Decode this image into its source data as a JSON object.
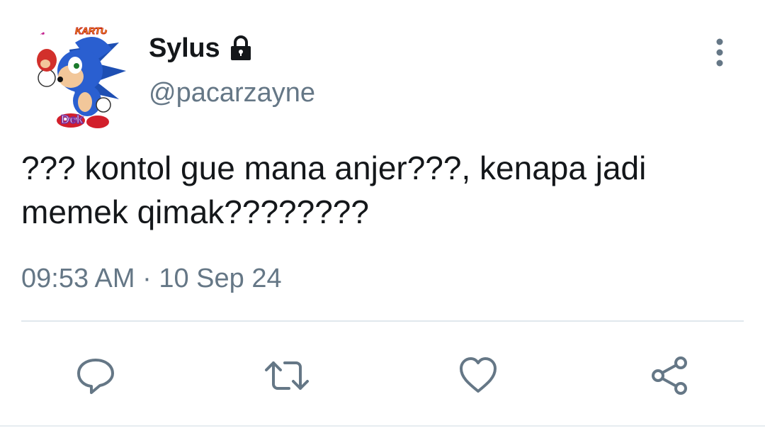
{
  "user": {
    "display_name": "Sylus",
    "handle": "@pacarzayne",
    "protected_icon": "lock-icon",
    "avatar": {
      "description_icon": "sonic-avatar",
      "badge_text": "Dek",
      "top_text_left": "ma",
      "top_text_right": "KARTU"
    }
  },
  "tweet": {
    "text": "??? kontol gue mana anjer???, kenapa jadi memek qimak????????",
    "timestamp": "09:53 AM · 10 Sep 24"
  },
  "actions": [
    {
      "name": "reply",
      "icon": "reply-icon"
    },
    {
      "name": "retweet",
      "icon": "retweet-icon"
    },
    {
      "name": "like",
      "icon": "heart-icon"
    },
    {
      "name": "share",
      "icon": "share-icon"
    }
  ],
  "colors": {
    "text_primary": "#14171a",
    "text_secondary": "#657786",
    "icon": "#657786",
    "divider": "#e1e8ed"
  }
}
